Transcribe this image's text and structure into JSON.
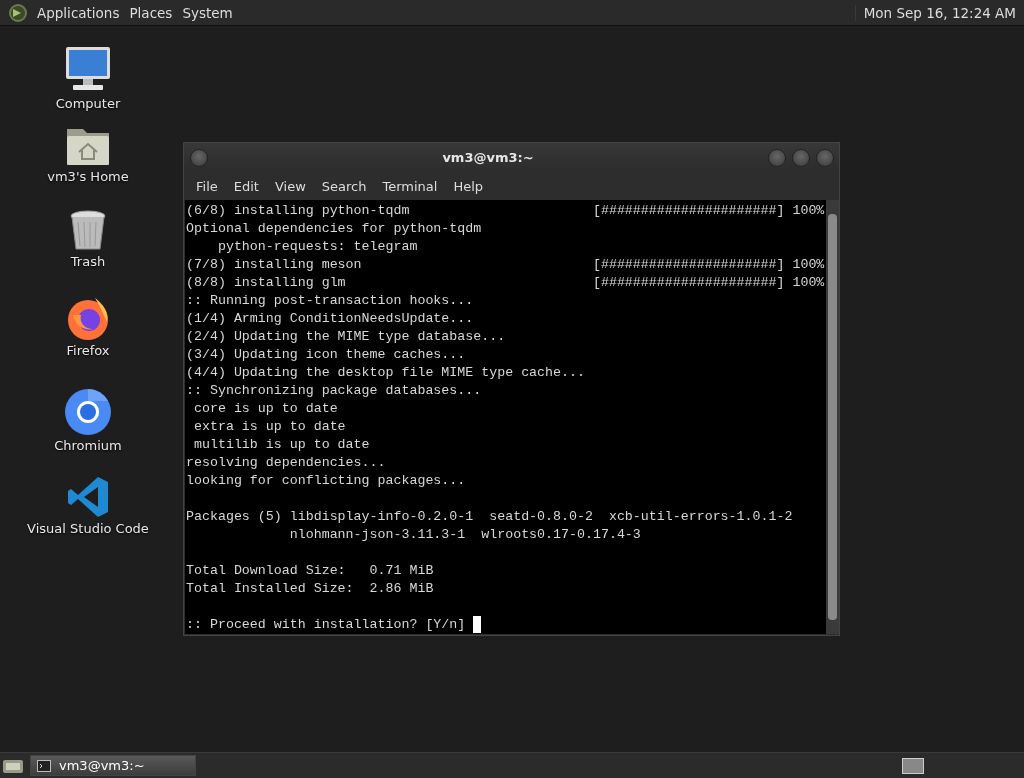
{
  "top_panel": {
    "menus": [
      "Applications",
      "Places",
      "System"
    ],
    "clock": "Mon Sep 16, 12:24 AM"
  },
  "desktop_icons": [
    {
      "kind": "computer",
      "label": "Computer"
    },
    {
      "kind": "home",
      "label": "vm3's Home"
    },
    {
      "kind": "trash",
      "label": "Trash"
    },
    {
      "kind": "firefox",
      "label": "Firefox"
    },
    {
      "kind": "chromium",
      "label": "Chromium"
    },
    {
      "kind": "vscode",
      "label": "Visual Studio Code"
    }
  ],
  "terminal_window": {
    "title": "vm3@vm3:~",
    "menu": [
      "File",
      "Edit",
      "View",
      "Search",
      "Terminal",
      "Help"
    ],
    "lines": [
      {
        "kind": "progress",
        "text": "(6/8) installing python-tqdm",
        "bar": "[######################] 100%"
      },
      {
        "kind": "text",
        "text": "Optional dependencies for python-tqdm"
      },
      {
        "kind": "text",
        "text": "    python-requests: telegram"
      },
      {
        "kind": "progress",
        "text": "(7/8) installing meson",
        "bar": "[######################] 100%"
      },
      {
        "kind": "progress",
        "text": "(8/8) installing glm",
        "bar": "[######################] 100%"
      },
      {
        "kind": "text",
        "text": ":: Running post-transaction hooks..."
      },
      {
        "kind": "text",
        "text": "(1/4) Arming ConditionNeedsUpdate..."
      },
      {
        "kind": "text",
        "text": "(2/4) Updating the MIME type database..."
      },
      {
        "kind": "text",
        "text": "(3/4) Updating icon theme caches..."
      },
      {
        "kind": "text",
        "text": "(4/4) Updating the desktop file MIME type cache..."
      },
      {
        "kind": "text",
        "text": ":: Synchronizing package databases..."
      },
      {
        "kind": "text",
        "text": " core is up to date"
      },
      {
        "kind": "text",
        "text": " extra is up to date"
      },
      {
        "kind": "text",
        "text": " multilib is up to date"
      },
      {
        "kind": "text",
        "text": "resolving dependencies..."
      },
      {
        "kind": "text",
        "text": "looking for conflicting packages..."
      },
      {
        "kind": "blank"
      },
      {
        "kind": "text",
        "text": "Packages (5) libdisplay-info-0.2.0-1  seatd-0.8.0-2  xcb-util-errors-1.0.1-2"
      },
      {
        "kind": "text",
        "text": "             nlohmann-json-3.11.3-1  wlroots0.17-0.17.4-3"
      },
      {
        "kind": "blank"
      },
      {
        "kind": "text",
        "text": "Total Download Size:   0.71 MiB"
      },
      {
        "kind": "text",
        "text": "Total Installed Size:  2.86 MiB"
      },
      {
        "kind": "blank"
      },
      {
        "kind": "prompt",
        "text": ":: Proceed with installation? [Y/n]"
      }
    ]
  },
  "taskbar": {
    "tasks": [
      {
        "label": "vm3@vm3:~",
        "selected": true
      }
    ]
  }
}
